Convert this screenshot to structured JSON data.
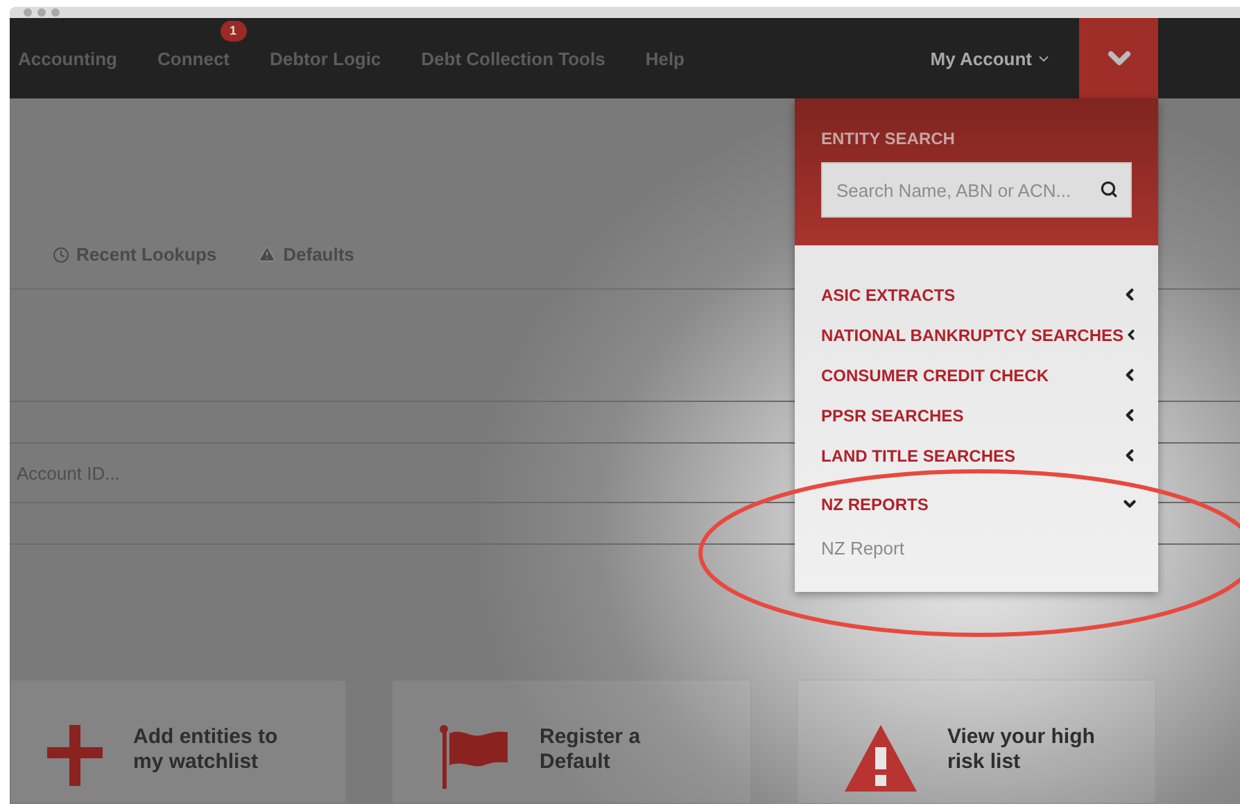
{
  "nav": {
    "items": [
      {
        "label": "Accounting"
      },
      {
        "label": "Connect",
        "badge": "1"
      },
      {
        "label": "Debtor Logic"
      },
      {
        "label": "Debt Collection Tools"
      },
      {
        "label": "Help"
      }
    ],
    "account": "My Account"
  },
  "subtabs": [
    {
      "label": "Recent Lookups",
      "kind": "clock"
    },
    {
      "label": "Defaults",
      "kind": "warning"
    }
  ],
  "lookup_field": {
    "placeholder": "Account ID..."
  },
  "dropdown": {
    "title": "ENTITY SEARCH",
    "search_placeholder": "Search Name, ABN or ACN...",
    "items": [
      {
        "label": "ASIC EXTRACTS",
        "expanded": false
      },
      {
        "label": "NATIONAL BANKRUPTCY SEARCHES",
        "expanded": false
      },
      {
        "label": "CONSUMER CREDIT CHECK",
        "expanded": false
      },
      {
        "label": "PPSR SEARCHES",
        "expanded": false
      },
      {
        "label": "LAND TITLE SEARCHES",
        "expanded": false
      },
      {
        "label": "NZ REPORTS",
        "expanded": true,
        "children": [
          {
            "label": "NZ Report"
          }
        ]
      }
    ]
  },
  "cards": [
    {
      "label": "Add entities to my watchlist",
      "kind": "plus"
    },
    {
      "label": "Register a Default",
      "kind": "flag"
    },
    {
      "label": "View your high risk list",
      "kind": "warning"
    }
  ]
}
